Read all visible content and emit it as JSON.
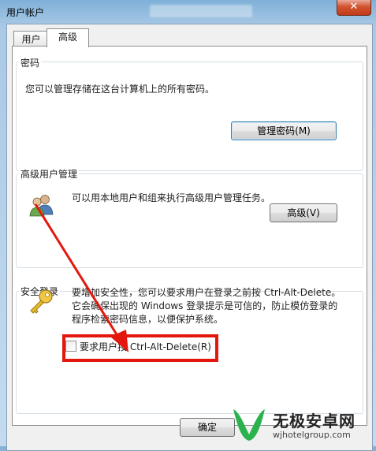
{
  "window": {
    "title": "用户帐户",
    "close_glyph": "✕"
  },
  "tabs": [
    {
      "label": "用户"
    },
    {
      "label": "高级"
    }
  ],
  "passwords": {
    "heading": "密码",
    "description": "您可以管理存储在这台计算机上的所有密码。",
    "button": "管理密码(M)"
  },
  "advanced_users": {
    "heading": "高级用户管理",
    "description": "可以用本地用户和组来执行高级用户管理任务。",
    "button": "高级(V)",
    "icon": "users-icon"
  },
  "secure_logon": {
    "heading": "安全登录",
    "desc_line1": "要增加安全性，您可以要求用户在登录之前按 Ctrl-Alt-Delete。",
    "desc_line2": "它会确保出现的 Windows 登录提示是可信的，防止模仿登录的",
    "desc_line3": "程序检索密码信息，以便保护系统。",
    "checkbox_label": "要求用户按 Ctrl-Alt-Delete(R)",
    "checkbox_checked": false,
    "icon": "key-icon"
  },
  "footer": {
    "ok_button": "确定"
  },
  "watermark": {
    "brand": "无极安卓网",
    "url": "wjhotelgroup.com"
  },
  "colors": {
    "highlight": "#e3170d",
    "close_button": "#c43a19",
    "brand_green": "#2bb24c"
  }
}
